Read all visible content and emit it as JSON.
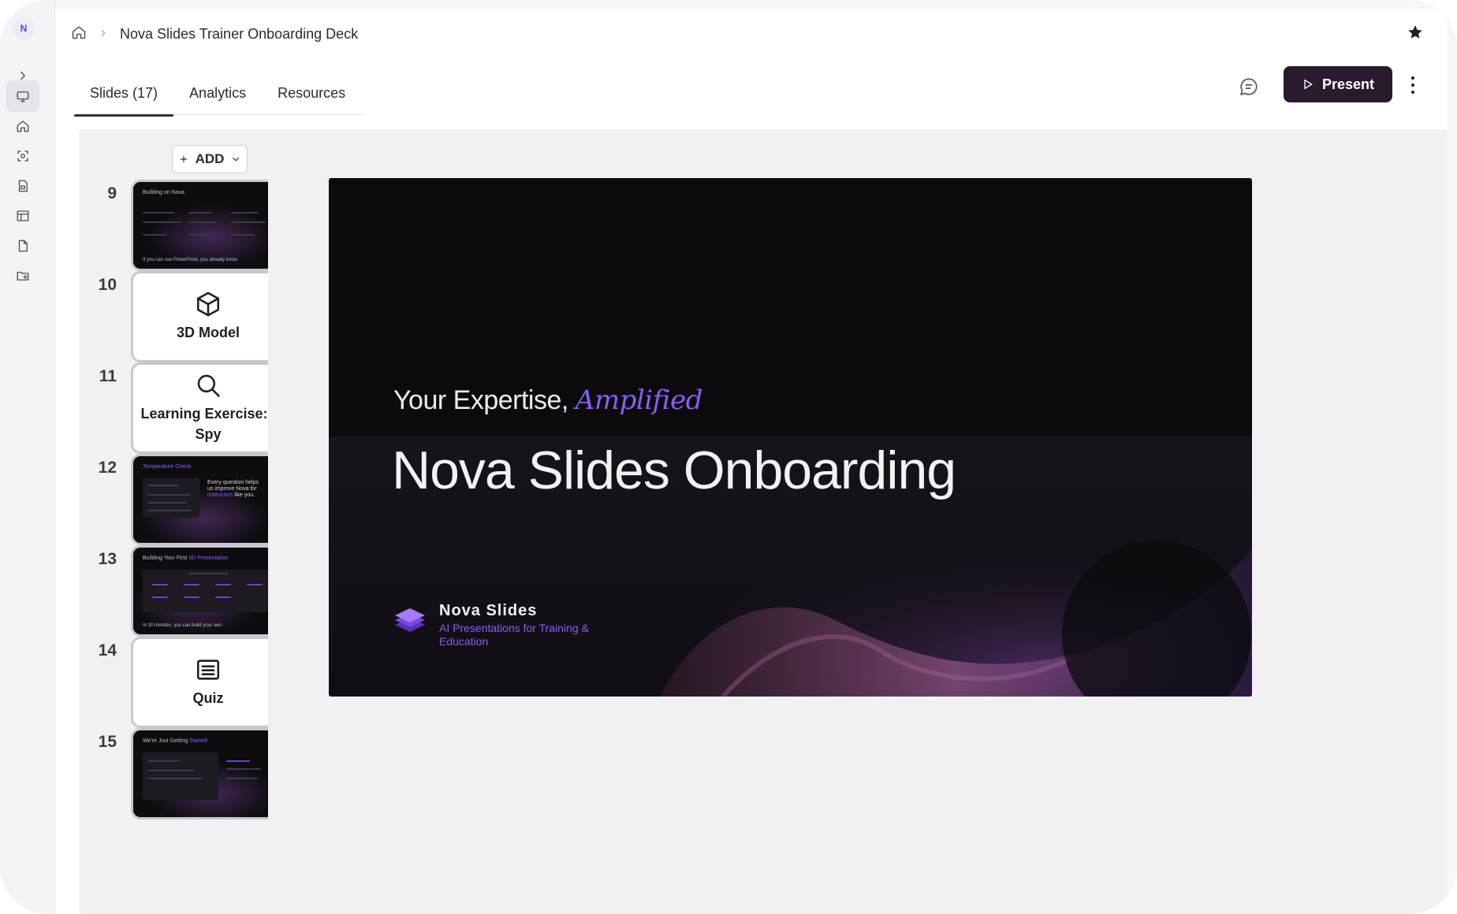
{
  "app": {
    "logo_letter": "N"
  },
  "rail": {
    "items": [
      {
        "icon": "chevron-right-icon"
      },
      {
        "icon": "slides-icon",
        "active": true
      },
      {
        "icon": "home-icon"
      },
      {
        "icon": "scan-icon"
      },
      {
        "icon": "media-file-icon"
      },
      {
        "icon": "layout-icon"
      },
      {
        "icon": "document-icon"
      },
      {
        "icon": "folder-settings-icon"
      }
    ]
  },
  "breadcrumb": {
    "title": "Nova Slides Trainer Onboarding Deck"
  },
  "tabs": [
    {
      "label": "Slides (17)",
      "active": true
    },
    {
      "label": "Analytics",
      "active": false
    },
    {
      "label": "Resources",
      "active": false
    }
  ],
  "toolbar": {
    "present_label": "Present",
    "add_label": "ADD"
  },
  "thumbnails": [
    {
      "number": "9",
      "type": "image",
      "title": "Building on Nova",
      "footer": "If you can use PowerPoint, you already know"
    },
    {
      "number": "10",
      "type": "block",
      "icon": "cube-icon",
      "label": "3D Model"
    },
    {
      "number": "11",
      "type": "block",
      "icon": "search-icon",
      "label": "Learning Exercise: I Spy"
    },
    {
      "number": "12",
      "type": "image",
      "title": "Temperature Check",
      "big_text": "Every question helps us improve Nova for",
      "accent": "instructors",
      "big_tail": "like you."
    },
    {
      "number": "13",
      "type": "image",
      "title": "Building Your First",
      "accent": "3D Presentation",
      "footer": "In 30 minutes, you can build your own"
    },
    {
      "number": "14",
      "type": "block",
      "icon": "list-icon",
      "label": "Quiz"
    },
    {
      "number": "15",
      "type": "image",
      "title": "We're Just Getting",
      "accent": "Started"
    }
  ],
  "slide": {
    "kicker": "Your Expertise,",
    "kicker_accent": "Amplified",
    "headline": "Nova Slides Onboarding",
    "brand_name": "Nova Slides",
    "brand_tagline": "AI Presentations for Training & Education"
  },
  "colors": {
    "accent": "#8b5cf6",
    "present_bg": "#2a1a2e",
    "slide_bg": "#0b0b0d"
  }
}
